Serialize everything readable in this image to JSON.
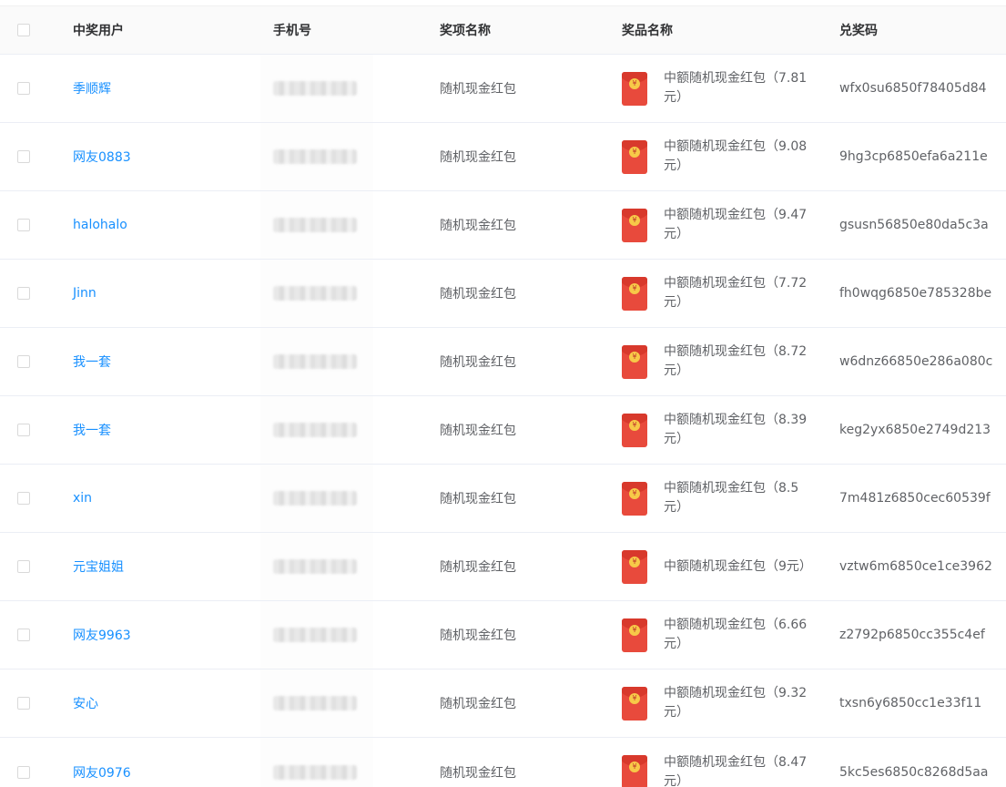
{
  "headers": {
    "user": "中奖用户",
    "phone": "手机号",
    "award": "奖项名称",
    "prize": "奖品名称",
    "code": "兑奖码"
  },
  "rows": [
    {
      "user": "季顺辉",
      "award": "随机现金红包",
      "prize": "中额随机现金红包（7.81元）",
      "code": "wfx0su6850f78405d84"
    },
    {
      "user": "网友0883",
      "award": "随机现金红包",
      "prize": "中额随机现金红包（9.08元）",
      "code": "9hg3cp6850efa6a211e"
    },
    {
      "user": "halohalo",
      "award": "随机现金红包",
      "prize": "中额随机现金红包（9.47元）",
      "code": "gsusn56850e80da5c3a"
    },
    {
      "user": "Jinn",
      "award": "随机现金红包",
      "prize": "中额随机现金红包（7.72元）",
      "code": "fh0wqg6850e785328be"
    },
    {
      "user": "我一套",
      "award": "随机现金红包",
      "prize": "中额随机现金红包（8.72元）",
      "code": "w6dnz66850e286a080c"
    },
    {
      "user": "我一套",
      "award": "随机现金红包",
      "prize": "中额随机现金红包（8.39元）",
      "code": "keg2yx6850e2749d213"
    },
    {
      "user": "xin",
      "award": "随机现金红包",
      "prize": "中额随机现金红包（8.5元）",
      "code": "7m481z6850cec60539f"
    },
    {
      "user": "元宝姐姐",
      "award": "随机现金红包",
      "prize": "中额随机现金红包（9元）",
      "code": "vztw6m6850ce1ce3962"
    },
    {
      "user": "网友9963",
      "award": "随机现金红包",
      "prize": "中额随机现金红包（6.66元）",
      "code": "z2792p6850cc355c4ef"
    },
    {
      "user": "安心",
      "award": "随机现金红包",
      "prize": "中额随机现金红包（9.32元）",
      "code": "txsn6y6850cc1e33f11"
    },
    {
      "user": "网友0976",
      "award": "随机现金红包",
      "prize": "中额随机现金红包（8.47元）",
      "code": "5kc5es6850c8268d5aa"
    }
  ],
  "icons": {
    "checkbox": "checkbox-icon",
    "envelope": "red-envelope-icon",
    "envelope_coin": "¥"
  },
  "colors": {
    "link": "#1890ff",
    "envelope": "#e84a3c",
    "header_bg": "#fafafa"
  }
}
